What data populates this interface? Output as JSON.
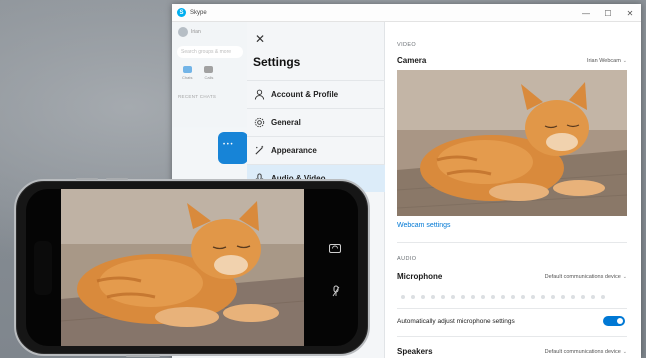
{
  "window": {
    "title": "Skype"
  },
  "window_controls": [
    "—",
    "☐",
    "✕"
  ],
  "skype_sidebar": {
    "user_name": "Irian",
    "search_placeholder": "Search groups & more",
    "tabs": [
      "Chats",
      "Calls"
    ],
    "recent_label": "RECENT CHATS"
  },
  "settings": {
    "title": "Settings",
    "close_label": "✕",
    "nav": [
      {
        "label": "Account & Profile",
        "icon": "person-icon"
      },
      {
        "label": "General",
        "icon": "gear-icon"
      },
      {
        "label": "Appearance",
        "icon": "wand-icon"
      },
      {
        "label": "Audio & Video",
        "icon": "microphone-icon",
        "active": true
      }
    ]
  },
  "content": {
    "video_section": "VIDEO",
    "camera_label": "Camera",
    "camera_value": "Irian Webcam",
    "webcam_settings_link": "Webcam settings",
    "audio_section": "AUDIO",
    "microphone_label": "Microphone",
    "microphone_value": "Default communications device",
    "auto_adjust_label": "Automatically adjust microphone settings",
    "auto_adjust_on": true,
    "speakers_label": "Speakers",
    "speakers_value": "Default communications device"
  },
  "colors": {
    "accent": "#0078d4",
    "nav_active_bg": "#dcecf9",
    "cat_fur": "#d98a3c"
  }
}
